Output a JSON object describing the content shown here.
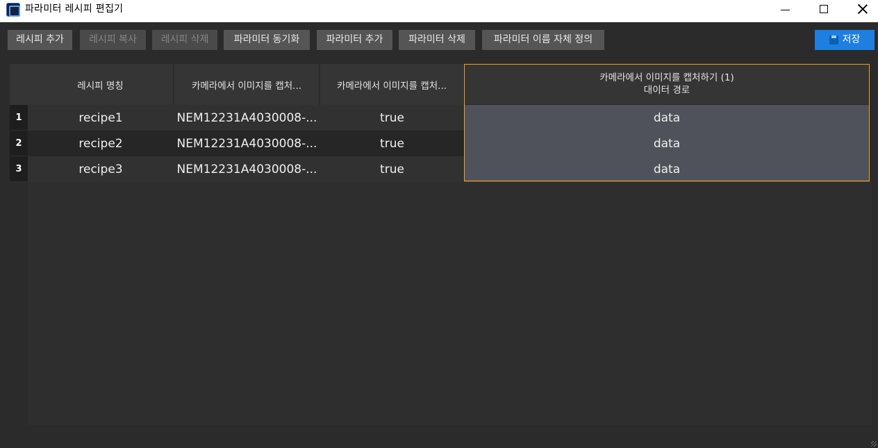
{
  "window": {
    "title": "파라미터 레시피 편집기"
  },
  "toolbar": {
    "add_recipe": "레시피 추가",
    "copy_recipe": "레시피 복사",
    "delete_recipe": "레시피 삭제",
    "sync_params": "파라미터 동기화",
    "add_param": "파라미터 추가",
    "delete_param": "파라미터 삭제",
    "custom_param_name": "파라미터 이름 자체 정의",
    "save": "저장"
  },
  "table": {
    "headers": [
      "레시피 명칭",
      "카메라에서 이미지를 캡처...",
      "카메라에서 이미지를 캡처...",
      "카메라에서 이미지를 캡처하기 (1)",
      "대이터 경로"
    ],
    "rows": [
      {
        "num": "1",
        "name": "recipe1",
        "col1": "NEM12231A4030008-...",
        "col2": "true",
        "col3": "data"
      },
      {
        "num": "2",
        "name": "recipe2",
        "col1": "NEM12231A4030008-...",
        "col2": "true",
        "col3": "data"
      },
      {
        "num": "3",
        "name": "recipe3",
        "col1": "NEM12231A4030008-...",
        "col2": "true",
        "col3": "data"
      }
    ]
  },
  "colors": {
    "accent": "#1e7fe0",
    "selection_border": "#f2a21b"
  }
}
